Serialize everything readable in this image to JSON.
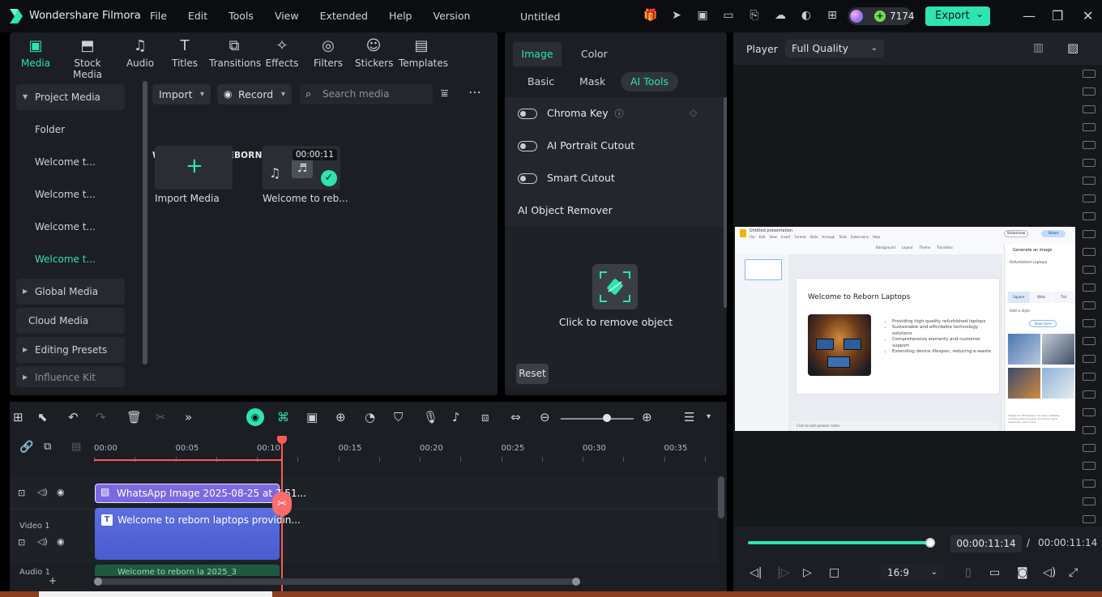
{
  "app": {
    "name": "Wondershare Filmora",
    "document_title": "Untitled",
    "menu": [
      "File",
      "Edit",
      "Tools",
      "View",
      "Extended",
      "Help",
      "Version"
    ],
    "credits": "7174",
    "export_label": "Export"
  },
  "media_tabs": [
    {
      "label": "Media",
      "icon": "media-icon",
      "active": true
    },
    {
      "label": "Stock Media",
      "icon": "stock-media-icon"
    },
    {
      "label": "Audio",
      "icon": "music-note-icon"
    },
    {
      "label": "Titles",
      "icon": "text-t-icon"
    },
    {
      "label": "Transitions",
      "icon": "transition-icon"
    },
    {
      "label": "Effects",
      "icon": "effects-icon"
    },
    {
      "label": "Filters",
      "icon": "filters-icon"
    },
    {
      "label": "Stickers",
      "icon": "stickers-icon"
    },
    {
      "label": "Templates",
      "icon": "templates-icon"
    }
  ],
  "sidebar": {
    "project_media": "Project Media",
    "folder": "Folder",
    "items": [
      "Welcome t...",
      "Welcome t...",
      "Welcome t...",
      "Welcome t..."
    ],
    "global_media": "Global Media",
    "cloud_media": "Cloud Media",
    "editing_presets": "Editing Presets",
    "influence_kit": "Influence Kit"
  },
  "media_toolbar": {
    "import": "Import",
    "record": "Record",
    "search_placeholder": "Search media"
  },
  "folder_title": "WELCOME TO REBORN LA 2025_3",
  "media_items": [
    {
      "label": "Import Media"
    },
    {
      "label": "Welcome to reb...",
      "duration": "00:00:11"
    }
  ],
  "properties": {
    "tabs": [
      "Image",
      "Color"
    ],
    "subtabs": [
      "Basic",
      "Mask",
      "AI Tools"
    ],
    "chroma_key": "Chroma Key",
    "ai_portrait": "AI Portrait Cutout",
    "smart_cutout": "Smart Cutout",
    "object_remover": "AI Object Remover",
    "remove_prompt": "Click to remove object",
    "reset": "Reset"
  },
  "player": {
    "label": "Player",
    "quality": "Full Quality",
    "current_time": "00:00:11:14",
    "separator": "/",
    "total_time": "00:00:11:14",
    "ratio": "16:9",
    "progress": 1.0,
    "slide": {
      "app_title": "Untitled presentation",
      "heading": "Welcome to Reborn Laptops",
      "bullets": [
        "Providing high-quality refurbished laptops",
        "Sustainable and affordable technology solutions",
        "Comprehensive warranty and customer support",
        "Extending device lifespan, reducing e-waste"
      ],
      "side_panel_title": "Generate an image",
      "side_prompt": "Refurbished Laptops",
      "speaker_notes": "Click to add speaker notes",
      "slideshow": "Slideshow",
      "share": "Share",
      "view_more": "View more",
      "add_style": "Add a style",
      "menu": [
        "File",
        "Edit",
        "View",
        "Insert",
        "Format",
        "Slide",
        "Arrange",
        "Tools",
        "Extensions",
        "Help"
      ],
      "toolbar": [
        "Background",
        "Layout",
        "Theme",
        "Transition"
      ],
      "ratios": [
        "Square",
        "Wide",
        "Tall"
      ],
      "disclaimer": "Images for Workspace can make mistakes, including about people, so double-check responses.",
      "learn_more": "Learn more"
    }
  },
  "timeline": {
    "ruler": [
      "00:00",
      "00:05",
      "00:10",
      "00:15",
      "00:20",
      "00:25",
      "00:30",
      "00:35"
    ],
    "clip_image": "WhatsApp Image 2025-08-25 at 7.51...",
    "clip_title": "Welcome to reborn laptops providin...",
    "clip_audio": "Welcome to reborn la 2025_3",
    "track_video": "Video 1",
    "track_audio": "Audio 1",
    "zoom": 0.45
  },
  "colors": {
    "accent": "#2ee4b0",
    "playhead": "#ff5a5a",
    "panel": "#1b1e23",
    "clip_image": "#7e68e0",
    "clip_title": "#4a5cd0"
  }
}
